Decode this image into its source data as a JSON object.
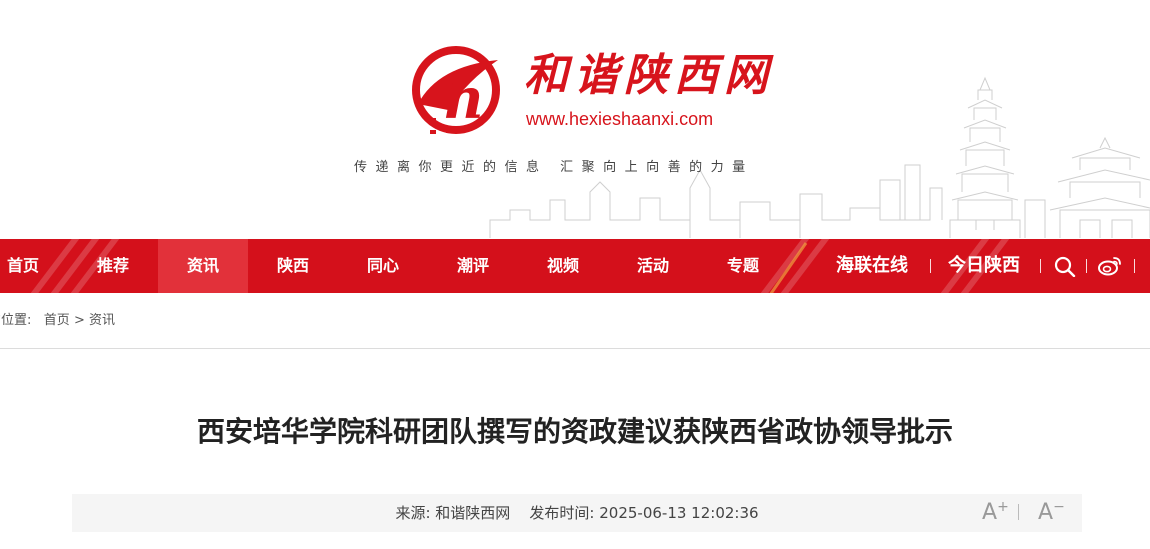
{
  "header": {
    "logo_name": "和谐陕西网",
    "logo_url": "www.hexieshaanxi.com",
    "logo_letter": "h",
    "slogan": "传递离你更近的信息  汇聚向上向善的力量",
    "brand_color": "#d7141c"
  },
  "nav": {
    "background_color": "#d4101b",
    "active_color": "#e2313a",
    "items": [
      {
        "label": "首页"
      },
      {
        "label": "推荐"
      },
      {
        "label": "资讯"
      },
      {
        "label": "陕西"
      },
      {
        "label": "同心"
      },
      {
        "label": "潮评"
      },
      {
        "label": "视频"
      },
      {
        "label": "活动"
      },
      {
        "label": "专题"
      }
    ],
    "active_item": "资讯",
    "right_links": [
      {
        "label": "海联在线"
      },
      {
        "label": "今日陕西"
      }
    ],
    "icons": [
      "search-icon",
      "weibo-icon"
    ]
  },
  "breadcrumb": {
    "prefix": "的位置:",
    "home": "首页",
    "separator": ">",
    "current": "资讯"
  },
  "article": {
    "title": "西安培华学院科研团队撰写的资政建议获陕西省政协领导批示",
    "source_label": "来源:",
    "source": "和谐陕西网",
    "time_label": "发布时间:",
    "time": "2025-06-13 12:02:36",
    "font_increase": "A",
    "font_increase_sign": "+",
    "font_decrease": "A",
    "font_decrease_sign": "−"
  }
}
